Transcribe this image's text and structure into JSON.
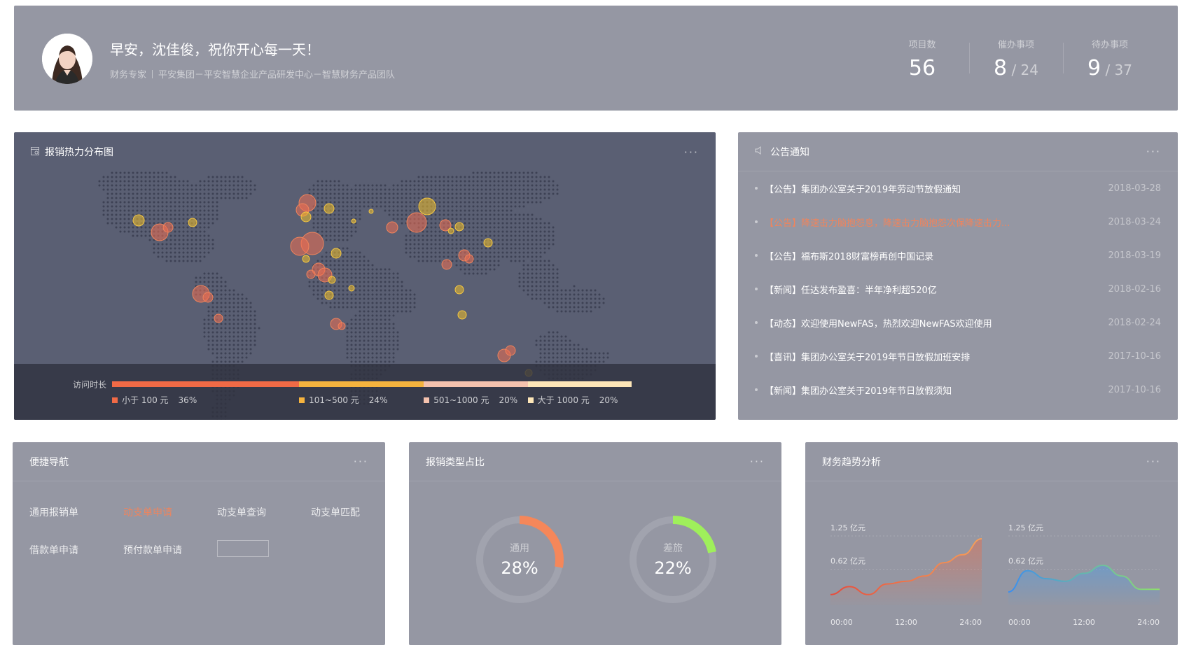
{
  "header": {
    "greeting": "早安，沈佳俊，祝你开心每一天！",
    "role": "财务专家",
    "org": "平安集团－平安智慧企业产品研发中心－智慧财务产品团队",
    "stats": [
      {
        "label": "项目数",
        "value": "56",
        "total": ""
      },
      {
        "label": "催办事项",
        "value": "8",
        "total": " / 24"
      },
      {
        "label": "待办事项",
        "value": "9",
        "total": " / 37"
      }
    ]
  },
  "heatmap": {
    "title": "报销热力分布图",
    "more": "···",
    "legend_title": "访问时长",
    "legend": [
      {
        "label": "小于 100 元",
        "pct": "36%",
        "share": 36,
        "color": "#f06a46"
      },
      {
        "label": "101~500 元",
        "pct": "24%",
        "share": 24,
        "color": "#f5b33e"
      },
      {
        "label": "501~1000 元",
        "pct": "20%",
        "share": 20,
        "color": "#f5c2ae"
      },
      {
        "label": "大于 1000 元",
        "pct": "20%",
        "share": 20,
        "color": "#fde6b8"
      }
    ]
  },
  "notices": {
    "title": "公告通知",
    "more": "···",
    "items": [
      {
        "text": "【公告】集团办公室关于2019年劳动节放假通知",
        "date": "2018-03-28",
        "highlight": false
      },
      {
        "text": "【公告】降速击力脑抱怨息，降速击力脑抱怨次保降速击力...",
        "date": "2018-03-24",
        "highlight": true
      },
      {
        "text": "【公告】福布斯2018财富榜再创中国记录",
        "date": "2018-03-19",
        "highlight": false
      },
      {
        "text": "【新闻】任达发布盈喜：半年净利超520亿",
        "date": "2018-02-16",
        "highlight": false
      },
      {
        "text": "【动态】欢迎使用NewFAS，热烈欢迎NewFAS欢迎使用",
        "date": "2018-02-24",
        "highlight": false
      },
      {
        "text": "【喜讯】集团办公室关于2019年节日放假加班安排",
        "date": "2017-10-16",
        "highlight": false
      },
      {
        "text": "【新闻】集团办公室关于2019年节日放假须知",
        "date": "2017-10-16",
        "highlight": false
      }
    ]
  },
  "quicknav": {
    "title": "便捷导航",
    "more": "···",
    "items": [
      "通用报销单",
      "动支单申请",
      "动支单查询",
      "动支单匹配",
      "借款单申请",
      "预付款单申请"
    ],
    "active_index": 1
  },
  "typeratio": {
    "title": "报销类型占比",
    "more": "···",
    "rings": [
      {
        "label": "通用",
        "value": "28%",
        "fraction": 0.28,
        "color": "#f5875a"
      },
      {
        "label": "差旅",
        "value": "22%",
        "fraction": 0.22,
        "color": "#9fef5b"
      }
    ]
  },
  "trend": {
    "title": "财务趋势分析",
    "more": "···",
    "y_labels": [
      "1.25 亿元",
      "0.62 亿元"
    ],
    "x_labels": [
      "00:00",
      "12:00",
      "24:00"
    ]
  },
  "chart_data": [
    {
      "type": "pie",
      "labels": [
        "通用"
      ],
      "values": [
        28
      ]
    },
    {
      "type": "pie",
      "labels": [
        "差旅"
      ],
      "values": [
        22
      ]
    },
    {
      "type": "area",
      "x": [
        "00:00",
        "03:00",
        "06:00",
        "09:00",
        "12:00",
        "15:00",
        "18:00",
        "21:00",
        "24:00"
      ],
      "series": [
        {
          "values": [
            0.2,
            0.35,
            0.2,
            0.4,
            0.45,
            0.55,
            0.8,
            0.95,
            1.3
          ]
        }
      ],
      "ylim": [
        0,
        1.25
      ],
      "color": "#f06a46"
    },
    {
      "type": "area",
      "x": [
        "00:00",
        "03:00",
        "06:00",
        "09:00",
        "12:00",
        "15:00",
        "18:00",
        "21:00",
        "24:00"
      ],
      "series": [
        {
          "values": [
            0.25,
            0.65,
            0.5,
            0.45,
            0.6,
            0.75,
            0.55,
            0.3,
            0.3
          ]
        }
      ],
      "ylim": [
        0,
        1.25
      ],
      "color": "#4a9eea"
    }
  ]
}
